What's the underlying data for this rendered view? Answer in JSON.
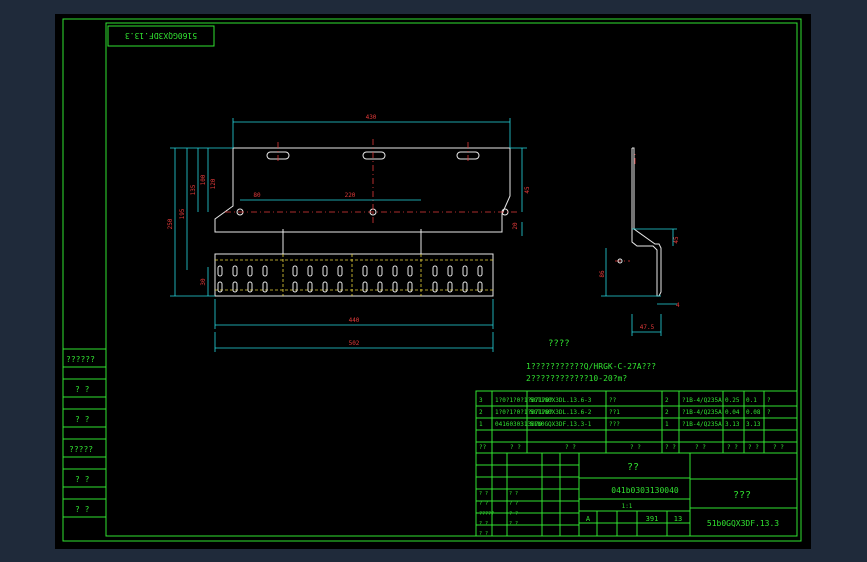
{
  "drawing_code_box": "5160GQX3DF.13.3",
  "dimensions": {
    "overall_width": "430",
    "bottom_inner": "440",
    "bottom_outer": "502",
    "hole_gap_left": "80",
    "hole_gap_mid": "220",
    "h_250": "250",
    "h_195": "195",
    "h_135": "135",
    "h_100": "100",
    "h_120": "120",
    "h_30": "30",
    "right_45": "45",
    "right_20": "20",
    "side_45": "45",
    "side_86": "86",
    "side_4": "4",
    "side_47_5": "47.5"
  },
  "notes": {
    "title": "????",
    "line1": "1???????????Q/HRGK-C-27A???",
    "line2": "2????????????10-20?m?"
  },
  "left_labels": [
    "??????",
    "? ?",
    "? ?",
    "?????",
    "? ?",
    "? ?"
  ],
  "parts_table": {
    "rows": [
      {
        "no": "3",
        "code": "1?0?1?0?1?0?1?0?",
        "name": "5GT1G0X3DL.13.6-3",
        "desc": "??",
        "qty": "2",
        "mat": "?1B-4/Q235A",
        "w1": "0.25",
        "w2": "0.1",
        "mark": "?"
      },
      {
        "no": "2",
        "code": "1?0?1?0?1?0?1?0?",
        "name": "5GT1G0X3DL.13.6-2",
        "desc": "??1",
        "qty": "2",
        "mat": "?1B-4/Q235A",
        "w1": "0.04",
        "w2": "0.08",
        "mark": "?"
      },
      {
        "no": "1",
        "code": "04160303130?0",
        "name": "51b0GQX3DF.13.3-1",
        "desc": "???",
        "qty": "1",
        "mat": "?1B-4/Q235A",
        "w1": "3.13",
        "w2": "3.13",
        "mark": ""
      }
    ],
    "header": [
      "??",
      "? ?",
      "? ?",
      "? ?",
      "? ?",
      "? ?",
      "? ?",
      "? ?",
      "? ?"
    ]
  },
  "title_block": {
    "name": "??",
    "part_code": "041b0303130040",
    "unit": "???",
    "drawing_no": "51b0GQX3DF.13.3",
    "stage": "A",
    "scale": "1:1",
    "sheet": "391",
    "weight": "13",
    "sign_labels": [
      "? ?",
      "? ?",
      "?????",
      "? ?",
      "? ?",
      "? ?",
      "? ?",
      "? ?",
      "? ?"
    ]
  }
}
